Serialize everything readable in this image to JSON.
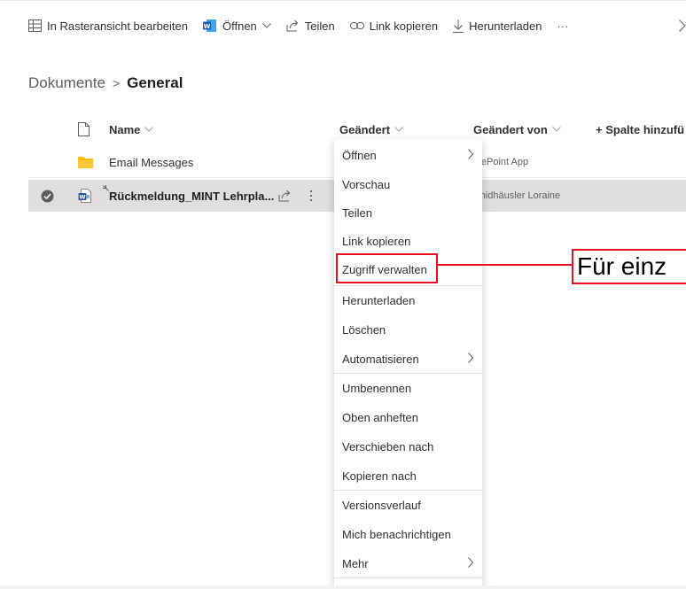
{
  "toolbar": {
    "grid_edit": "In Rasteransicht bearbeiten",
    "open": "Öffnen",
    "share": "Teilen",
    "copy_link": "Link kopieren",
    "download": "Herunterladen",
    "more": "···"
  },
  "breadcrumb": {
    "parent": "Dokumente",
    "separator": ">",
    "current": "General"
  },
  "columns": {
    "name": "Name",
    "modified": "Geändert",
    "modified_by": "Geändert von",
    "add_column": "+ Spalte hinzufü"
  },
  "rows": [
    {
      "name": "Email Messages",
      "modified_by": "harePoint App",
      "type": "folder"
    },
    {
      "name": "Rückmeldung_MINT Lehrpla...",
      "modified_by": "chmidhäusler Loraine",
      "type": "word",
      "selected": true
    }
  ],
  "context_menu": [
    {
      "label": "Öffnen",
      "submenu": true
    },
    {
      "label": "Vorschau"
    },
    {
      "label": "Teilen"
    },
    {
      "label": "Link kopieren"
    },
    {
      "label": "Zugriff verwalten",
      "highlighted": true
    },
    {
      "label": "Herunterladen"
    },
    {
      "label": "Löschen"
    },
    {
      "label": "Automatisieren",
      "submenu": true
    },
    {
      "label": "Umbenennen"
    },
    {
      "label": "Oben anheften"
    },
    {
      "label": "Verschieben nach"
    },
    {
      "label": "Kopieren nach"
    },
    {
      "label": "Versionsverlauf"
    },
    {
      "label": "Mich benachrichtigen"
    },
    {
      "label": "Mehr",
      "submenu": true
    }
  ],
  "callout": {
    "text": "Für einz"
  },
  "colors": {
    "highlight": "#e81123",
    "word_blue": "#2b579a",
    "folder_yellow": "#ffb900",
    "selected_row": "#e1dfdd"
  }
}
